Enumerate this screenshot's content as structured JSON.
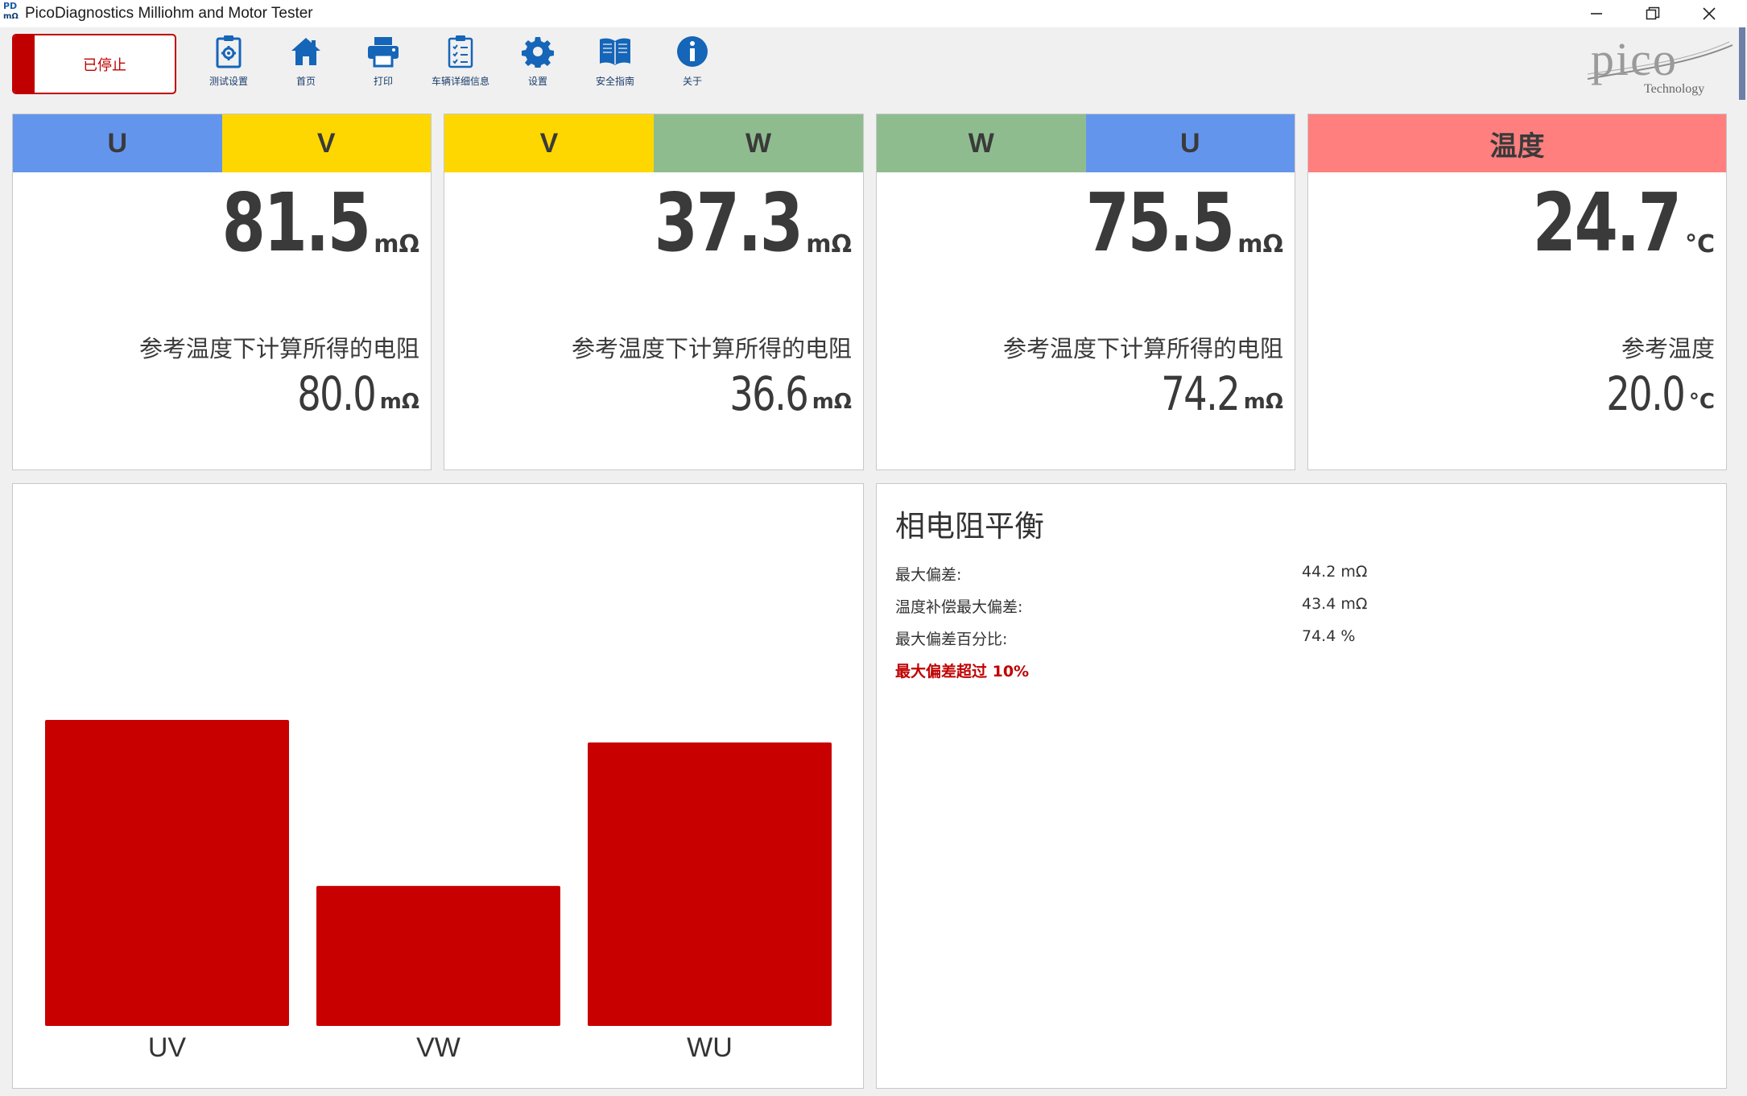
{
  "window": {
    "title": "PicoDiagnostics Milliohm and Motor Tester",
    "icon_top": "PD",
    "icon_bottom": "mΩ",
    "minimize": "minimize-icon",
    "restore": "restore-icon",
    "close": "close-icon"
  },
  "toolbar": {
    "stop_label": "已停止",
    "items": [
      {
        "label": "测试设置",
        "icon": "test-settings-icon"
      },
      {
        "label": "首页",
        "icon": "home-icon"
      },
      {
        "label": "打印",
        "icon": "printer-icon"
      },
      {
        "label": "车辆详细信息",
        "icon": "vehicle-details-icon"
      },
      {
        "label": "设置",
        "icon": "gear-icon"
      },
      {
        "label": "安全指南",
        "icon": "book-icon"
      },
      {
        "label": "关于",
        "icon": "info-icon"
      }
    ],
    "logo": {
      "name": "pico",
      "sub": "Technology"
    }
  },
  "colors": {
    "U": "#6495ed",
    "V": "#ffd700",
    "W": "#8fbc8f",
    "temp": "#ff7f7f",
    "bar": "#c80000",
    "alert": "#c00000"
  },
  "cards": [
    {
      "heads": [
        "U",
        "V"
      ],
      "value": "81.5",
      "unit": "mΩ",
      "ref_label": "参考温度下计算所得的电阻",
      "ref_value": "80.0",
      "ref_unit": "mΩ"
    },
    {
      "heads": [
        "V",
        "W"
      ],
      "value": "37.3",
      "unit": "mΩ",
      "ref_label": "参考温度下计算所得的电阻",
      "ref_value": "36.6",
      "ref_unit": "mΩ"
    },
    {
      "heads": [
        "W",
        "U"
      ],
      "value": "75.5",
      "unit": "mΩ",
      "ref_label": "参考温度下计算所得的电阻",
      "ref_value": "74.2",
      "ref_unit": "mΩ"
    },
    {
      "heads": [
        "温度"
      ],
      "value": "24.7",
      "unit": "°C",
      "ref_label": "参考温度",
      "ref_value": "20.0",
      "ref_unit": "°C"
    }
  ],
  "chart_data": {
    "type": "bar",
    "categories": [
      "UV",
      "VW",
      "WU"
    ],
    "values": [
      81.5,
      37.3,
      75.5
    ],
    "title": "",
    "xlabel": "",
    "ylabel": "",
    "ylim": [
      0,
      81.5
    ],
    "grid": false
  },
  "balance": {
    "title": "相电阻平衡",
    "rows": [
      {
        "label": "最大偏差:",
        "value": "44.2 mΩ"
      },
      {
        "label": "温度补偿最大偏差:",
        "value": "43.4 mΩ"
      },
      {
        "label": "最大偏差百分比:",
        "value": "74.4 %"
      }
    ],
    "warning": "最大偏差超过 10%"
  }
}
